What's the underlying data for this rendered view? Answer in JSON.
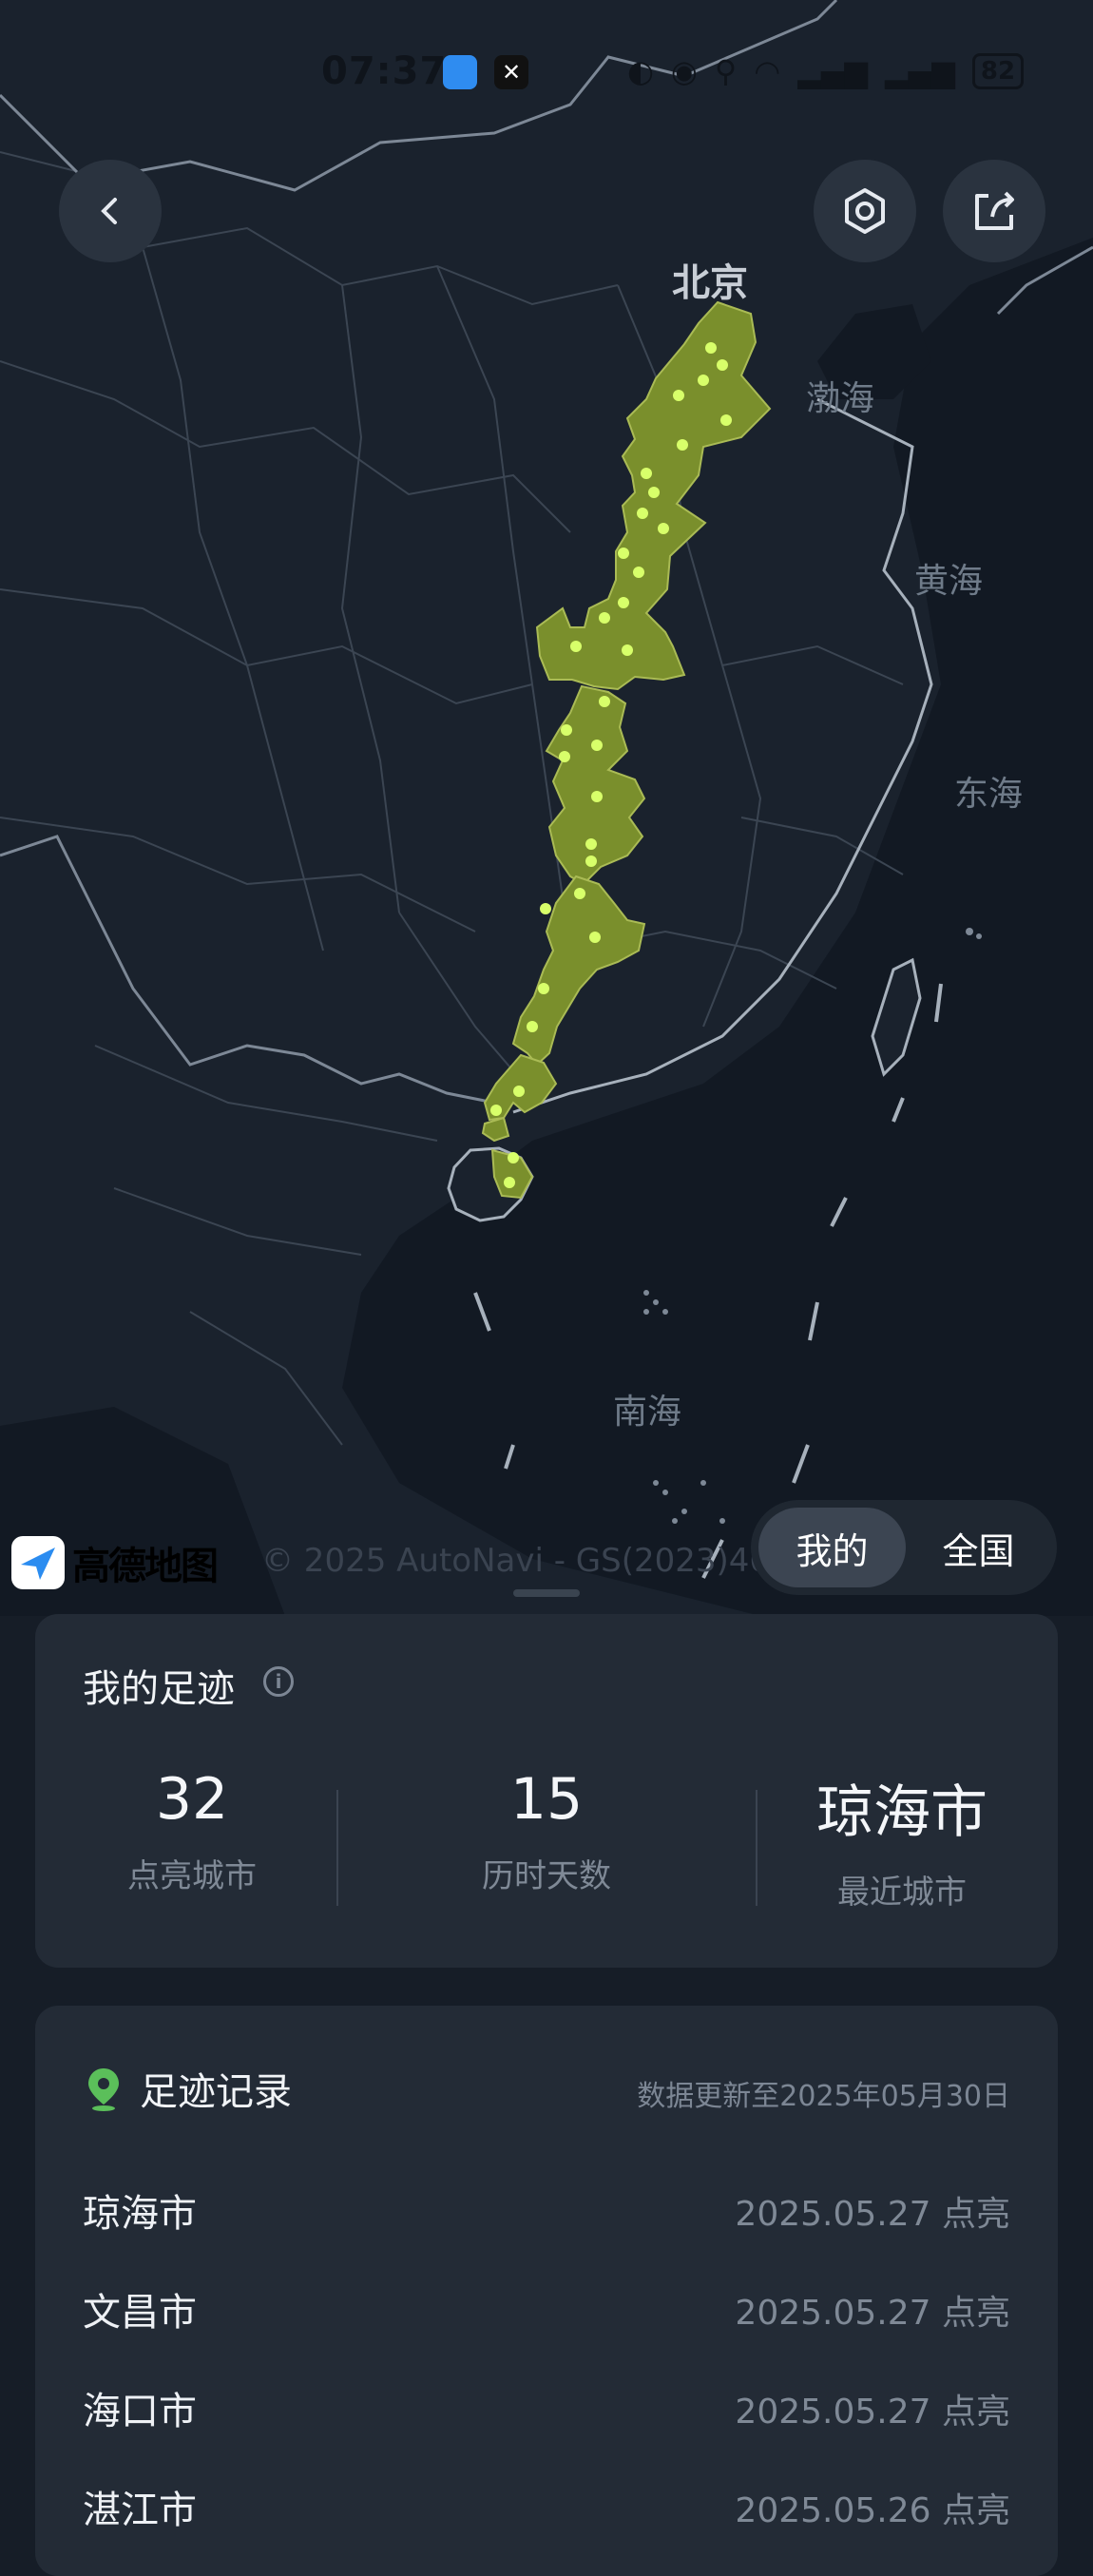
{
  "status_bar": {
    "time": "07:37",
    "battery": "82"
  },
  "map": {
    "label_city": "北京",
    "label_bohai": "渤海",
    "label_huanghai": "黄海",
    "label_donghai": "东海",
    "label_nanhai": "南海",
    "logo_text": "高德地图",
    "copyright": "© 2025 AutoNavi - GS(2023)467",
    "highlight_color": "#7a8f2c",
    "dot_color": "#d8ff6a"
  },
  "toggle": {
    "mine": "我的",
    "national": "全国",
    "selected": "我的"
  },
  "footprint": {
    "title": "我的足迹",
    "stats": [
      {
        "value": "32",
        "label": "点亮城市"
      },
      {
        "value": "15",
        "label": "历时天数"
      },
      {
        "value": "琼海市",
        "label": "最近城市"
      }
    ]
  },
  "records": {
    "title": "足迹记录",
    "updated": "数据更新至2025年05月30日",
    "items": [
      {
        "city": "琼海市",
        "date": "2025.05.27 点亮"
      },
      {
        "city": "文昌市",
        "date": "2025.05.27 点亮"
      },
      {
        "city": "海口市",
        "date": "2025.05.27 点亮"
      },
      {
        "city": "湛江市",
        "date": "2025.05.26 点亮"
      }
    ]
  }
}
